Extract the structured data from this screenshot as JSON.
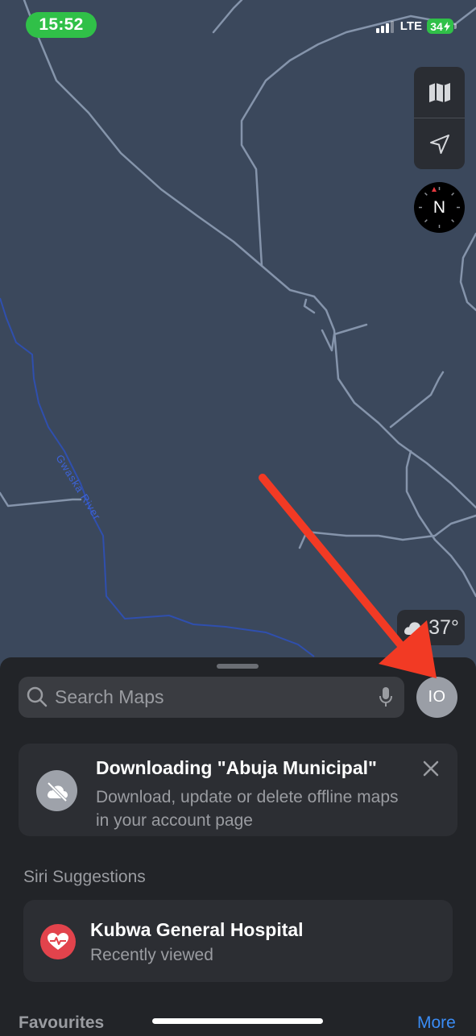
{
  "status_bar": {
    "time": "15:52",
    "network": "LTE",
    "battery_level": "34"
  },
  "map": {
    "river_label": "Gwaska River",
    "compass_label": "N",
    "weather_temp": "37°",
    "weather_icon": "cloud-icon",
    "colors": {
      "background": "#3b485c",
      "roads": "#8e9db4",
      "river": "#2f4fae"
    }
  },
  "map_controls": {
    "map_mode_icon": "map-icon",
    "location_icon": "location-arrow-icon"
  },
  "sheet": {
    "search_placeholder": "Search Maps",
    "avatar_initials": "IO",
    "download_banner": {
      "title": "Downloading \"Abuja Municipal\"",
      "description": "Download, update or delete offline maps in your account page"
    },
    "siri_section_title": "Siri Suggestions",
    "suggestion": {
      "title": "Kubwa General Hospital",
      "subtitle": "Recently viewed"
    },
    "favourites_title": "Favourites",
    "more_label": "More"
  },
  "annotation": {
    "arrow_color": "#f23a24"
  }
}
